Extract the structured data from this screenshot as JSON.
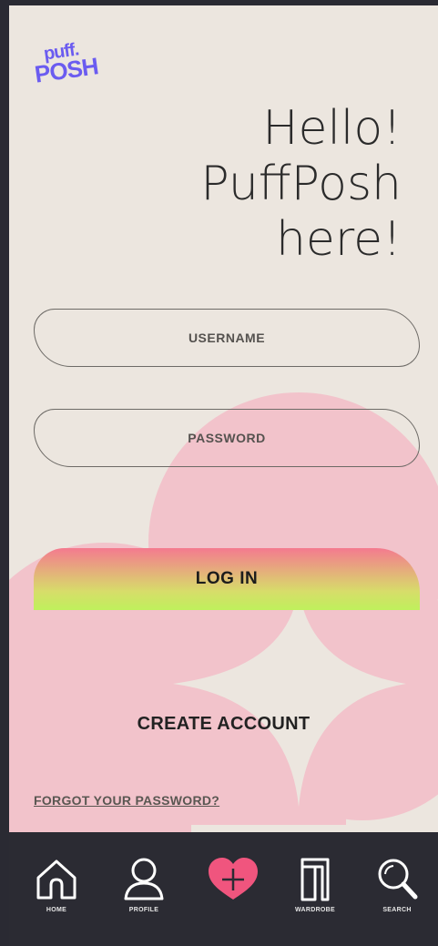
{
  "logo": {
    "line1": "puff.",
    "line2": "POSH"
  },
  "greeting": {
    "line1": "Hello!",
    "line2": "PuffPosh",
    "line3": "here!"
  },
  "form": {
    "username_placeholder": "USERNAME",
    "password_placeholder": "PASSWORD",
    "login_label": "LOG IN",
    "create_account_label": "CREATE ACCOUNT",
    "forgot_label": "FORGOT YOUR PASSWORD?"
  },
  "nav": {
    "items": [
      {
        "label": "HOME",
        "icon": "home-icon"
      },
      {
        "label": "PROFILE",
        "icon": "profile-icon"
      },
      {
        "label": "",
        "icon": "add-heart-icon"
      },
      {
        "label": "WARDROBE",
        "icon": "wardrobe-icon"
      },
      {
        "label": "SEARCH",
        "icon": "search-icon"
      }
    ]
  },
  "colors": {
    "background": "#ece6df",
    "blob": "#f2c3cb",
    "accent_heart": "#f0557e",
    "logo": "#6b5cf0",
    "login_gradient_top": "#f47a8f",
    "login_gradient_bottom": "#bff05c",
    "navbar": "#2b2b33"
  }
}
